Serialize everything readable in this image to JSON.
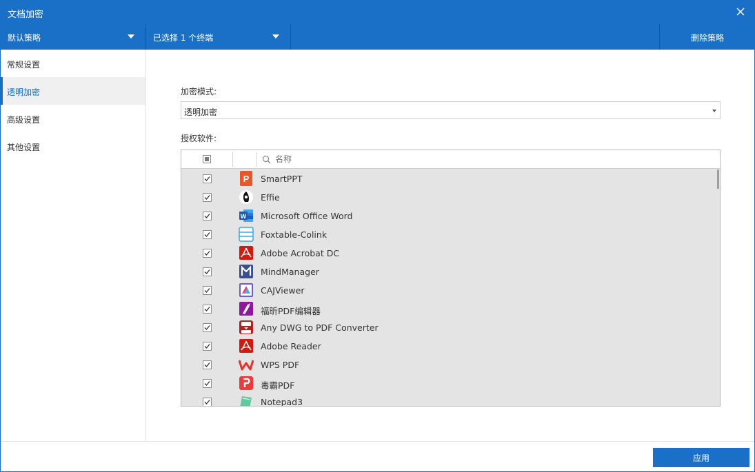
{
  "window": {
    "title": "文档加密"
  },
  "toolbar": {
    "policy_label": "默认策略",
    "terminal_label": "已选择 1 个终端",
    "delete_label": "删除策略"
  },
  "sidebar": {
    "items": [
      {
        "label": "常规设置",
        "active": false
      },
      {
        "label": "透明加密",
        "active": true
      },
      {
        "label": "高级设置",
        "active": false
      },
      {
        "label": "其他设置",
        "active": false
      }
    ]
  },
  "main": {
    "mode_label": "加密模式:",
    "mode_value": "透明加密",
    "software_label": "授权软件:",
    "table": {
      "search_placeholder": "名称",
      "rows": [
        {
          "name": "SmartPPT",
          "icon": "smartppt-icon",
          "checked": true
        },
        {
          "name": "Effie",
          "icon": "effie-icon",
          "checked": true
        },
        {
          "name": "Microsoft Office Word",
          "icon": "word-icon",
          "checked": true
        },
        {
          "name": "Foxtable-Colink",
          "icon": "foxtable-icon",
          "checked": true
        },
        {
          "name": "Adobe Acrobat DC",
          "icon": "acrobat-icon",
          "checked": true
        },
        {
          "name": "MindManager",
          "icon": "mindmanager-icon",
          "checked": true
        },
        {
          "name": "CAJViewer",
          "icon": "cajviewer-icon",
          "checked": true
        },
        {
          "name": "福昕PDF编辑器",
          "icon": "foxit-icon",
          "checked": true
        },
        {
          "name": "Any DWG to PDF Converter",
          "icon": "dwg-pdf-icon",
          "checked": true
        },
        {
          "name": "Adobe Reader",
          "icon": "adobe-reader-icon",
          "checked": true
        },
        {
          "name": "WPS PDF",
          "icon": "wps-pdf-icon",
          "checked": true
        },
        {
          "name": "毒霸PDF",
          "icon": "duba-pdf-icon",
          "checked": true
        },
        {
          "name": "Notepad3",
          "icon": "notepad3-icon",
          "checked": true
        }
      ]
    }
  },
  "footer": {
    "apply_label": "应用"
  },
  "colors": {
    "accent": "#1a6fc6",
    "table_bg": "#e4e4e4"
  }
}
